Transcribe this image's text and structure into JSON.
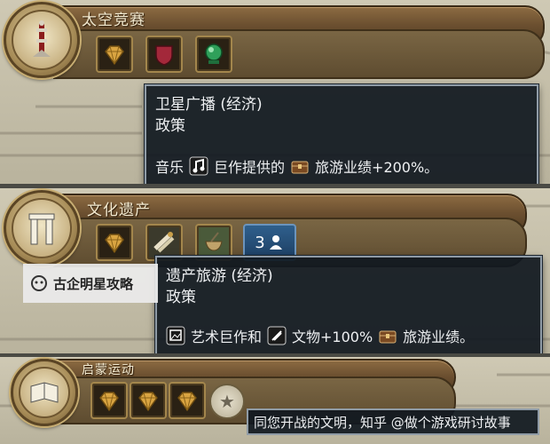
{
  "panels": [
    {
      "title": "太空竞赛",
      "tooltip": {
        "heading": "卫星广播 (经济)",
        "subheading": "政策",
        "effect": {
          "prefix": "音乐",
          "middle": "巨作提供的",
          "suffix": "旅游业绩+200%。"
        }
      }
    },
    {
      "title": "文化遗产",
      "count_badge": "3",
      "tooltip": {
        "heading": "遗产旅游 (经济)",
        "subheading": "政策",
        "effect": {
          "prefix": "艺术巨作和",
          "middle": "文物+100%",
          "suffix": "旅游业绩。"
        }
      }
    },
    {
      "title": "启蒙运动",
      "caption": "同您开战的文明，知乎 @做个游戏研讨故事"
    }
  ],
  "watermark": {
    "text": "古企明星攻略"
  },
  "icons": {
    "emblem_1": "tower-icon",
    "emblem_2": "gate-icon",
    "emblem_3": "book-icon",
    "slot_gold": "gold-gem-slot-icon",
    "slot_red": "red-shield-slot-icon",
    "slot_green": "green-orb-slot-icon",
    "music": "music-note-icon",
    "tourism": "tourism-chest-icon",
    "art": "art-frame-icon",
    "artifact": "artifact-icon",
    "star": "star-icon"
  },
  "colors": {
    "tooltip_bg": "#101820",
    "bar_brown": "#6c5030",
    "badge_blue": "#2f5f8c"
  }
}
